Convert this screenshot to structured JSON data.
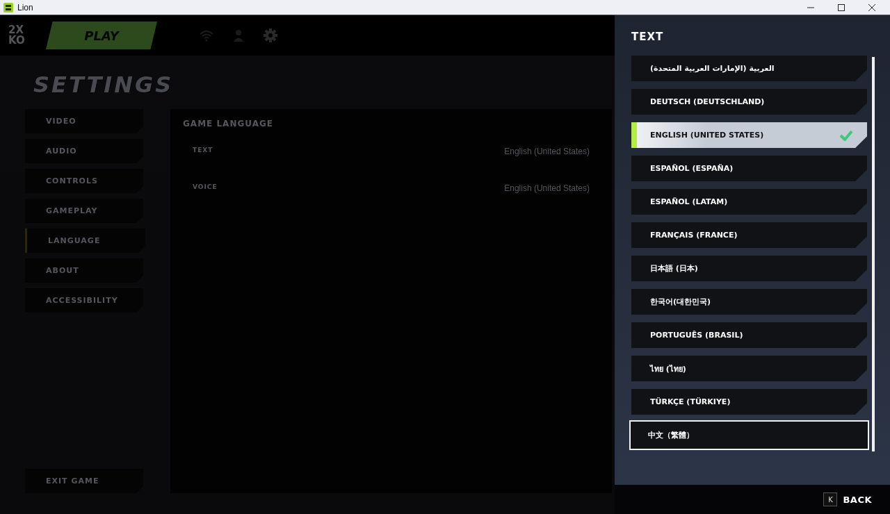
{
  "window": {
    "title": "Lion"
  },
  "top_bar": {
    "logo_lines": [
      "2X",
      "KO"
    ],
    "play_button": "PLAY"
  },
  "page_title": "SETTINGS",
  "nav": [
    {
      "label": "VIDEO",
      "selected": false
    },
    {
      "label": "AUDIO",
      "selected": false
    },
    {
      "label": "CONTROLS",
      "selected": false
    },
    {
      "label": "GAMEPLAY",
      "selected": false
    },
    {
      "label": "LANGUAGE",
      "selected": true
    },
    {
      "label": "ABOUT",
      "selected": false
    },
    {
      "label": "ACCESSIBILITY",
      "selected": false
    }
  ],
  "exit_button": "EXIT GAME",
  "panel": {
    "title": "GAME LANGUAGE",
    "rows": [
      {
        "label": "TEXT",
        "value": "English (United States)"
      },
      {
        "label": "VOICE",
        "value": "English (United States)"
      }
    ]
  },
  "language_picker": {
    "title": "TEXT",
    "options": [
      {
        "label": "العربية (الإمارات العربية المتحدة)",
        "selected": false,
        "focused": false
      },
      {
        "label": "DEUTSCH (DEUTSCHLAND)",
        "selected": false,
        "focused": false
      },
      {
        "label": "ENGLISH (UNITED STATES)",
        "selected": true,
        "focused": false
      },
      {
        "label": "ESPAÑOL (ESPAÑA)",
        "selected": false,
        "focused": false
      },
      {
        "label": "ESPAÑOL (LATAM)",
        "selected": false,
        "focused": false
      },
      {
        "label": "FRANÇAIS (FRANCE)",
        "selected": false,
        "focused": false
      },
      {
        "label": "日本語 (日本)",
        "selected": false,
        "focused": false
      },
      {
        "label": "한국어(대한민국)",
        "selected": false,
        "focused": false
      },
      {
        "label": "PORTUGUÊS (BRASIL)",
        "selected": false,
        "focused": false
      },
      {
        "label": "ไทย (ไทย)",
        "selected": false,
        "focused": false
      },
      {
        "label": "TÜRKÇE (TÜRKIYE)",
        "selected": false,
        "focused": false
      },
      {
        "label": "中文（繁體）",
        "selected": false,
        "focused": true
      }
    ]
  },
  "footer": {
    "key": "K",
    "label": "BACK"
  }
}
